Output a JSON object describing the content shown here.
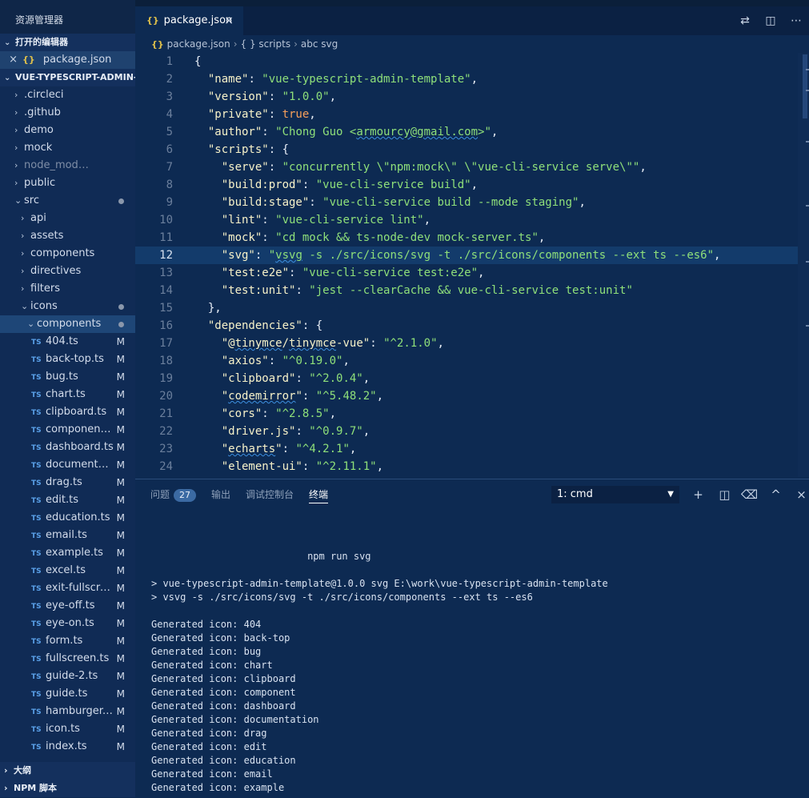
{
  "sidebar": {
    "title": "资源管理器",
    "open_editors_label": "打开的编辑器",
    "open_editor_file": "package.json",
    "project_label": "VUE-TYPESCRIPT-ADMIN-...",
    "folders": [
      {
        "label": ".circleci"
      },
      {
        "label": ".github"
      },
      {
        "label": "demo"
      },
      {
        "label": "mock"
      },
      {
        "label": "node_modules"
      },
      {
        "label": "public"
      },
      {
        "label": "src"
      }
    ],
    "src_children": [
      {
        "label": "api"
      },
      {
        "label": "assets"
      },
      {
        "label": "components"
      },
      {
        "label": "directives"
      },
      {
        "label": "filters"
      },
      {
        "label": "icons"
      }
    ],
    "components_folder": "components",
    "ts_badge": "TS",
    "modified_badge": "M",
    "files": [
      {
        "label": "404.ts"
      },
      {
        "label": "back-top.ts"
      },
      {
        "label": "bug.ts"
      },
      {
        "label": "chart.ts"
      },
      {
        "label": "clipboard.ts"
      },
      {
        "label": "component.ts"
      },
      {
        "label": "dashboard.ts"
      },
      {
        "label": "documentati..."
      },
      {
        "label": "drag.ts"
      },
      {
        "label": "edit.ts"
      },
      {
        "label": "education.ts"
      },
      {
        "label": "email.ts"
      },
      {
        "label": "example.ts"
      },
      {
        "label": "excel.ts"
      },
      {
        "label": "exit-fullscree..."
      },
      {
        "label": "eye-off.ts"
      },
      {
        "label": "eye-on.ts"
      },
      {
        "label": "form.ts"
      },
      {
        "label": "fullscreen.ts"
      },
      {
        "label": "guide-2.ts"
      },
      {
        "label": "guide.ts"
      },
      {
        "label": "hamburger.ts"
      },
      {
        "label": "icon.ts"
      },
      {
        "label": "index.ts"
      }
    ],
    "outline_label": "大纲",
    "npm_label": "NPM 脚本"
  },
  "tab": {
    "icon": "{}",
    "label": "package.json",
    "close": "×"
  },
  "breadcrumb": {
    "file": "package.json",
    "scripts": "{ } scripts",
    "item": "abc svg"
  },
  "editor": {
    "current_line": 12,
    "lines": [
      {
        "n": "1",
        "parts": [
          [
            "p",
            "{"
          ]
        ]
      },
      {
        "n": "2",
        "parts": [
          [
            "p",
            "  "
          ],
          [
            "k",
            "\"name\""
          ],
          [
            "p",
            ": "
          ],
          [
            "s",
            "\"vue-typescript-admin-template\""
          ],
          [
            "p",
            ","
          ]
        ]
      },
      {
        "n": "3",
        "parts": [
          [
            "p",
            "  "
          ],
          [
            "k",
            "\"version\""
          ],
          [
            "p",
            ": "
          ],
          [
            "s",
            "\"1.0.0\""
          ],
          [
            "p",
            ","
          ]
        ]
      },
      {
        "n": "4",
        "parts": [
          [
            "p",
            "  "
          ],
          [
            "k",
            "\"private\""
          ],
          [
            "p",
            ": "
          ],
          [
            "b",
            "true"
          ],
          [
            "p",
            ","
          ]
        ]
      },
      {
        "n": "5",
        "parts": [
          [
            "p",
            "  "
          ],
          [
            "k",
            "\"author\""
          ],
          [
            "p",
            ": "
          ],
          [
            "s",
            "\"Chong Guo <"
          ],
          [
            "sq",
            "armourcy@gmail.com"
          ],
          [
            "s",
            ">\""
          ],
          [
            "p",
            ","
          ]
        ]
      },
      {
        "n": "6",
        "parts": [
          [
            "p",
            "  "
          ],
          [
            "k",
            "\"scripts\""
          ],
          [
            "p",
            ": {"
          ]
        ]
      },
      {
        "n": "7",
        "parts": [
          [
            "p",
            "    "
          ],
          [
            "k",
            "\"serve\""
          ],
          [
            "p",
            ": "
          ],
          [
            "s",
            "\"concurrently \\\"npm:mock\\\" \\\"vue-cli-service serve\\\"\""
          ],
          [
            "p",
            ","
          ]
        ]
      },
      {
        "n": "8",
        "parts": [
          [
            "p",
            "    "
          ],
          [
            "k",
            "\"build:prod\""
          ],
          [
            "p",
            ": "
          ],
          [
            "s",
            "\"vue-cli-service build\""
          ],
          [
            "p",
            ","
          ]
        ]
      },
      {
        "n": "9",
        "parts": [
          [
            "p",
            "    "
          ],
          [
            "k",
            "\"build:stage\""
          ],
          [
            "p",
            ": "
          ],
          [
            "s",
            "\"vue-cli-service build --mode staging\""
          ],
          [
            "p",
            ","
          ]
        ]
      },
      {
        "n": "10",
        "parts": [
          [
            "p",
            "    "
          ],
          [
            "k",
            "\"lint\""
          ],
          [
            "p",
            ": "
          ],
          [
            "s",
            "\"vue-cli-service lint\""
          ],
          [
            "p",
            ","
          ]
        ]
      },
      {
        "n": "11",
        "parts": [
          [
            "p",
            "    "
          ],
          [
            "k",
            "\"mock\""
          ],
          [
            "p",
            ": "
          ],
          [
            "s",
            "\"cd mock && ts-node-dev mock-server.ts\""
          ],
          [
            "p",
            ","
          ]
        ]
      },
      {
        "n": "12",
        "parts": [
          [
            "p",
            "    "
          ],
          [
            "k",
            "\"svg\""
          ],
          [
            "p",
            ": "
          ],
          [
            "s",
            "\""
          ],
          [
            "sq",
            "vsvg"
          ],
          [
            "s",
            " -s ./src/icons/svg -t ./src/icons/components --ext ts --es6\""
          ],
          [
            "p",
            ","
          ]
        ]
      },
      {
        "n": "13",
        "parts": [
          [
            "p",
            "    "
          ],
          [
            "k",
            "\"test:e2e\""
          ],
          [
            "p",
            ": "
          ],
          [
            "s",
            "\"vue-cli-service test:e2e\""
          ],
          [
            "p",
            ","
          ]
        ]
      },
      {
        "n": "14",
        "parts": [
          [
            "p",
            "    "
          ],
          [
            "k",
            "\"test:unit\""
          ],
          [
            "p",
            ": "
          ],
          [
            "s",
            "\"jest --clearCache && vue-cli-service test:unit\""
          ]
        ]
      },
      {
        "n": "15",
        "parts": [
          [
            "p",
            "  },"
          ]
        ]
      },
      {
        "n": "16",
        "parts": [
          [
            "p",
            "  "
          ],
          [
            "k",
            "\"dependencies\""
          ],
          [
            "p",
            ": {"
          ]
        ]
      },
      {
        "n": "17",
        "parts": [
          [
            "p",
            "    "
          ],
          [
            "k",
            "\"@"
          ],
          [
            "ksq",
            "tinymce"
          ],
          [
            "k",
            "/"
          ],
          [
            "ksq",
            "tinymce"
          ],
          [
            "k",
            "-vue\""
          ],
          [
            "p",
            ": "
          ],
          [
            "s",
            "\"^2.1.0\""
          ],
          [
            "p",
            ","
          ]
        ]
      },
      {
        "n": "18",
        "parts": [
          [
            "p",
            "    "
          ],
          [
            "k",
            "\"axios\""
          ],
          [
            "p",
            ": "
          ],
          [
            "s",
            "\"^0.19.0\""
          ],
          [
            "p",
            ","
          ]
        ]
      },
      {
        "n": "19",
        "parts": [
          [
            "p",
            "    "
          ],
          [
            "k",
            "\"clipboard\""
          ],
          [
            "p",
            ": "
          ],
          [
            "s",
            "\"^2.0.4\""
          ],
          [
            "p",
            ","
          ]
        ]
      },
      {
        "n": "20",
        "parts": [
          [
            "p",
            "    "
          ],
          [
            "k",
            "\""
          ],
          [
            "ksq",
            "codemirror"
          ],
          [
            "k",
            "\""
          ],
          [
            "p",
            ": "
          ],
          [
            "s",
            "\"^5.48.2\""
          ],
          [
            "p",
            ","
          ]
        ]
      },
      {
        "n": "21",
        "parts": [
          [
            "p",
            "    "
          ],
          [
            "k",
            "\"cors\""
          ],
          [
            "p",
            ": "
          ],
          [
            "s",
            "\"^2.8.5\""
          ],
          [
            "p",
            ","
          ]
        ]
      },
      {
        "n": "22",
        "parts": [
          [
            "p",
            "    "
          ],
          [
            "k",
            "\"driver.js\""
          ],
          [
            "p",
            ": "
          ],
          [
            "s",
            "\"^0.9.7\""
          ],
          [
            "p",
            ","
          ]
        ]
      },
      {
        "n": "23",
        "parts": [
          [
            "p",
            "    "
          ],
          [
            "k",
            "\""
          ],
          [
            "ksq",
            "echarts"
          ],
          [
            "k",
            "\""
          ],
          [
            "p",
            ": "
          ],
          [
            "s",
            "\"^4.2.1\""
          ],
          [
            "p",
            ","
          ]
        ]
      },
      {
        "n": "24",
        "parts": [
          [
            "p",
            "    "
          ],
          [
            "k",
            "\"element-ui\""
          ],
          [
            "p",
            ": "
          ],
          [
            "s",
            "\"^2.11.1\""
          ],
          [
            "p",
            ","
          ]
        ]
      }
    ]
  },
  "panel": {
    "tabs": [
      {
        "label": "问题",
        "badge": "27"
      },
      {
        "label": "输出"
      },
      {
        "label": "调试控制台"
      },
      {
        "label": "终端"
      }
    ],
    "terminal_select": "1: cmd",
    "terminal_lines": [
      "                           npm run svg",
      "",
      "> vue-typescript-admin-template@1.0.0 svg E:\\work\\vue-typescript-admin-template",
      "> vsvg -s ./src/icons/svg -t ./src/icons/components --ext ts --es6",
      "",
      "Generated icon: 404",
      "Generated icon: back-top",
      "Generated icon: bug",
      "Generated icon: chart",
      "Generated icon: clipboard",
      "Generated icon: component",
      "Generated icon: dashboard",
      "Generated icon: documentation",
      "Generated icon: drag",
      "Generated icon: edit",
      "Generated icon: education",
      "Generated icon: email",
      "Generated icon: example"
    ]
  },
  "icons": {
    "new_terminal": "+",
    "split": "▯",
    "trash": "🗑",
    "maximize": "^",
    "close": "×",
    "compare": "⇄",
    "split_editor": "◫",
    "more": "⋯"
  }
}
